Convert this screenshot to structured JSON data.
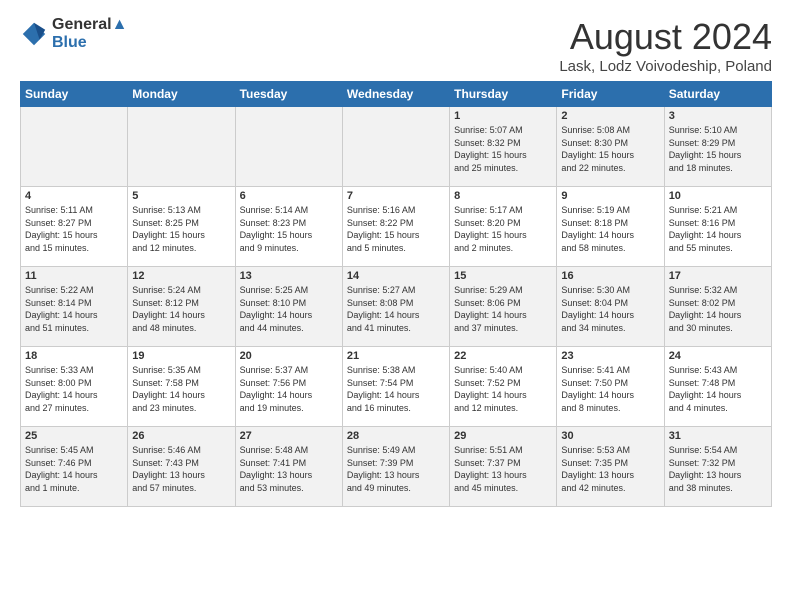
{
  "logo": {
    "line1": "General",
    "line2": "Blue"
  },
  "title": "August 2024",
  "location": "Lask, Lodz Voivodeship, Poland",
  "days_header": [
    "Sunday",
    "Monday",
    "Tuesday",
    "Wednesday",
    "Thursday",
    "Friday",
    "Saturday"
  ],
  "weeks": [
    [
      {
        "day": "",
        "info": ""
      },
      {
        "day": "",
        "info": ""
      },
      {
        "day": "",
        "info": ""
      },
      {
        "day": "",
        "info": ""
      },
      {
        "day": "1",
        "info": "Sunrise: 5:07 AM\nSunset: 8:32 PM\nDaylight: 15 hours\nand 25 minutes."
      },
      {
        "day": "2",
        "info": "Sunrise: 5:08 AM\nSunset: 8:30 PM\nDaylight: 15 hours\nand 22 minutes."
      },
      {
        "day": "3",
        "info": "Sunrise: 5:10 AM\nSunset: 8:29 PM\nDaylight: 15 hours\nand 18 minutes."
      }
    ],
    [
      {
        "day": "4",
        "info": "Sunrise: 5:11 AM\nSunset: 8:27 PM\nDaylight: 15 hours\nand 15 minutes."
      },
      {
        "day": "5",
        "info": "Sunrise: 5:13 AM\nSunset: 8:25 PM\nDaylight: 15 hours\nand 12 minutes."
      },
      {
        "day": "6",
        "info": "Sunrise: 5:14 AM\nSunset: 8:23 PM\nDaylight: 15 hours\nand 9 minutes."
      },
      {
        "day": "7",
        "info": "Sunrise: 5:16 AM\nSunset: 8:22 PM\nDaylight: 15 hours\nand 5 minutes."
      },
      {
        "day": "8",
        "info": "Sunrise: 5:17 AM\nSunset: 8:20 PM\nDaylight: 15 hours\nand 2 minutes."
      },
      {
        "day": "9",
        "info": "Sunrise: 5:19 AM\nSunset: 8:18 PM\nDaylight: 14 hours\nand 58 minutes."
      },
      {
        "day": "10",
        "info": "Sunrise: 5:21 AM\nSunset: 8:16 PM\nDaylight: 14 hours\nand 55 minutes."
      }
    ],
    [
      {
        "day": "11",
        "info": "Sunrise: 5:22 AM\nSunset: 8:14 PM\nDaylight: 14 hours\nand 51 minutes."
      },
      {
        "day": "12",
        "info": "Sunrise: 5:24 AM\nSunset: 8:12 PM\nDaylight: 14 hours\nand 48 minutes."
      },
      {
        "day": "13",
        "info": "Sunrise: 5:25 AM\nSunset: 8:10 PM\nDaylight: 14 hours\nand 44 minutes."
      },
      {
        "day": "14",
        "info": "Sunrise: 5:27 AM\nSunset: 8:08 PM\nDaylight: 14 hours\nand 41 minutes."
      },
      {
        "day": "15",
        "info": "Sunrise: 5:29 AM\nSunset: 8:06 PM\nDaylight: 14 hours\nand 37 minutes."
      },
      {
        "day": "16",
        "info": "Sunrise: 5:30 AM\nSunset: 8:04 PM\nDaylight: 14 hours\nand 34 minutes."
      },
      {
        "day": "17",
        "info": "Sunrise: 5:32 AM\nSunset: 8:02 PM\nDaylight: 14 hours\nand 30 minutes."
      }
    ],
    [
      {
        "day": "18",
        "info": "Sunrise: 5:33 AM\nSunset: 8:00 PM\nDaylight: 14 hours\nand 27 minutes."
      },
      {
        "day": "19",
        "info": "Sunrise: 5:35 AM\nSunset: 7:58 PM\nDaylight: 14 hours\nand 23 minutes."
      },
      {
        "day": "20",
        "info": "Sunrise: 5:37 AM\nSunset: 7:56 PM\nDaylight: 14 hours\nand 19 minutes."
      },
      {
        "day": "21",
        "info": "Sunrise: 5:38 AM\nSunset: 7:54 PM\nDaylight: 14 hours\nand 16 minutes."
      },
      {
        "day": "22",
        "info": "Sunrise: 5:40 AM\nSunset: 7:52 PM\nDaylight: 14 hours\nand 12 minutes."
      },
      {
        "day": "23",
        "info": "Sunrise: 5:41 AM\nSunset: 7:50 PM\nDaylight: 14 hours\nand 8 minutes."
      },
      {
        "day": "24",
        "info": "Sunrise: 5:43 AM\nSunset: 7:48 PM\nDaylight: 14 hours\nand 4 minutes."
      }
    ],
    [
      {
        "day": "25",
        "info": "Sunrise: 5:45 AM\nSunset: 7:46 PM\nDaylight: 14 hours\nand 1 minute."
      },
      {
        "day": "26",
        "info": "Sunrise: 5:46 AM\nSunset: 7:43 PM\nDaylight: 13 hours\nand 57 minutes."
      },
      {
        "day": "27",
        "info": "Sunrise: 5:48 AM\nSunset: 7:41 PM\nDaylight: 13 hours\nand 53 minutes."
      },
      {
        "day": "28",
        "info": "Sunrise: 5:49 AM\nSunset: 7:39 PM\nDaylight: 13 hours\nand 49 minutes."
      },
      {
        "day": "29",
        "info": "Sunrise: 5:51 AM\nSunset: 7:37 PM\nDaylight: 13 hours\nand 45 minutes."
      },
      {
        "day": "30",
        "info": "Sunrise: 5:53 AM\nSunset: 7:35 PM\nDaylight: 13 hours\nand 42 minutes."
      },
      {
        "day": "31",
        "info": "Sunrise: 5:54 AM\nSunset: 7:32 PM\nDaylight: 13 hours\nand 38 minutes."
      }
    ]
  ]
}
